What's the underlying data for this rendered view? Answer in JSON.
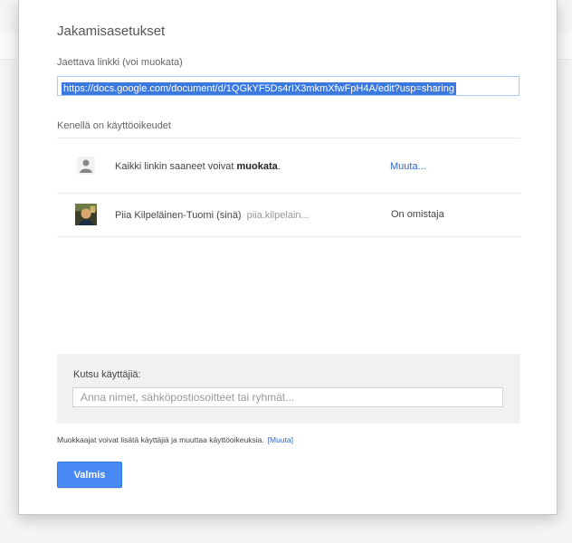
{
  "dialog": {
    "title": "Jakamisasetukset",
    "link_label": "Jaettava linkki (voi muokata)",
    "link_value": "https://docs.google.com/document/d/1QGkYF5Ds4rIX3mkmXfwFpH4A/edit?usp=sharing",
    "access_label": "Kenellä on käyttöoikeudet"
  },
  "access_rows": [
    {
      "icon": "person-link-icon",
      "text_prefix": "Kaikki linkin saaneet voivat",
      "text_bold": "muokata",
      "text_suffix": ".",
      "action": "Muuta..."
    },
    {
      "icon": "user-avatar",
      "name": "Piia Kilpeläinen-Tuomi (sinä)",
      "email": "piia.kilpelain...",
      "role": "On omistaja"
    }
  ],
  "invite": {
    "label": "Kutsu käyttäjiä:",
    "placeholder": "Anna nimet, sähköpostiosoitteet tai ryhmät..."
  },
  "footer": {
    "note": "Muokkaajat voivat lisätä käyttäjiä ja muuttaa käyttöoikeuksia.",
    "note_link": "[Muuta]",
    "done_label": "Valmis"
  },
  "colors": {
    "primary_button": "#4a8af4",
    "link": "#3366cc",
    "selection": "#3b79e0"
  }
}
